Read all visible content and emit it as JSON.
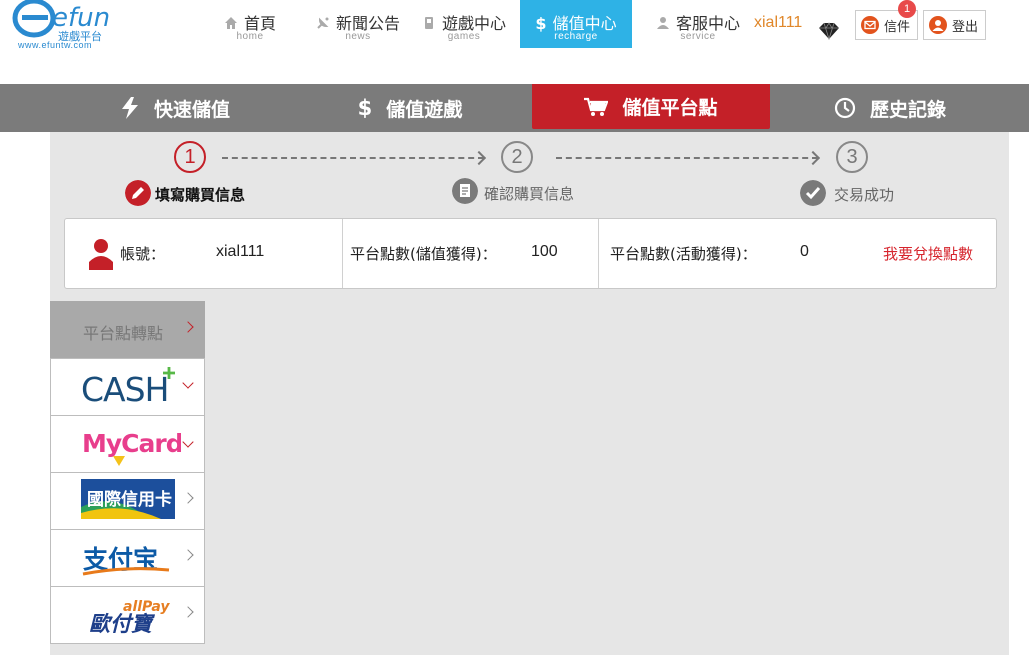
{
  "brand": {
    "logo_text": "efun",
    "logo_sub": "遊戲平台",
    "url_text": "www.efuntw.com"
  },
  "nav": [
    {
      "label": "首頁",
      "sub": "home",
      "icon": "home-icon"
    },
    {
      "label": "新聞公告",
      "sub": "news",
      "icon": "satellite-icon"
    },
    {
      "label": "遊戲中心",
      "sub": "games",
      "icon": "gamepad-icon"
    },
    {
      "label": "儲值中心",
      "sub": "recharge",
      "icon": "dollar-icon",
      "active": true
    },
    {
      "label": "客服中心",
      "sub": "service",
      "icon": "person-icon"
    }
  ],
  "user": {
    "name": "xial111",
    "mail_label": "信件",
    "mail_badge": "1",
    "logout_label": "登出"
  },
  "tabs": [
    {
      "label": "快速儲值",
      "icon": "lightning-icon"
    },
    {
      "label": "儲值遊戲",
      "icon": "dollar-icon"
    },
    {
      "label": "儲值平台點",
      "icon": "cart-icon",
      "active": true
    },
    {
      "label": "歷史記錄",
      "icon": "clock-icon"
    }
  ],
  "steps": [
    {
      "num": "1",
      "label": "填寫購買信息",
      "active": true
    },
    {
      "num": "2",
      "label": "確認購買信息",
      "active": false
    },
    {
      "num": "3",
      "label": "交易成功",
      "active": false
    }
  ],
  "account": {
    "account_label": "帳號：",
    "account_value": "xial111",
    "points_recharge_label": "平台點數(儲值獲得)：",
    "points_recharge_value": "100",
    "points_event_label": "平台點數(活動獲得)：",
    "points_event_value": "0",
    "redeem_link": "我要兌換點數"
  },
  "payment_menu": {
    "header": "平台點轉點",
    "items": [
      {
        "name": "cash-plus",
        "text": "CASH"
      },
      {
        "name": "mycard",
        "text": "MyCard"
      },
      {
        "name": "credit-card",
        "text": "國際信用卡"
      },
      {
        "name": "alipay",
        "text": "支付宝"
      },
      {
        "name": "allpay",
        "text": "歐付寶",
        "sub_text": "allPay"
      }
    ]
  },
  "colors": {
    "accent_red": "#c42028",
    "nav_active_blue": "#2eb2e6",
    "username_orange": "#e0872a",
    "tabbar_gray": "#7b7b7b"
  }
}
